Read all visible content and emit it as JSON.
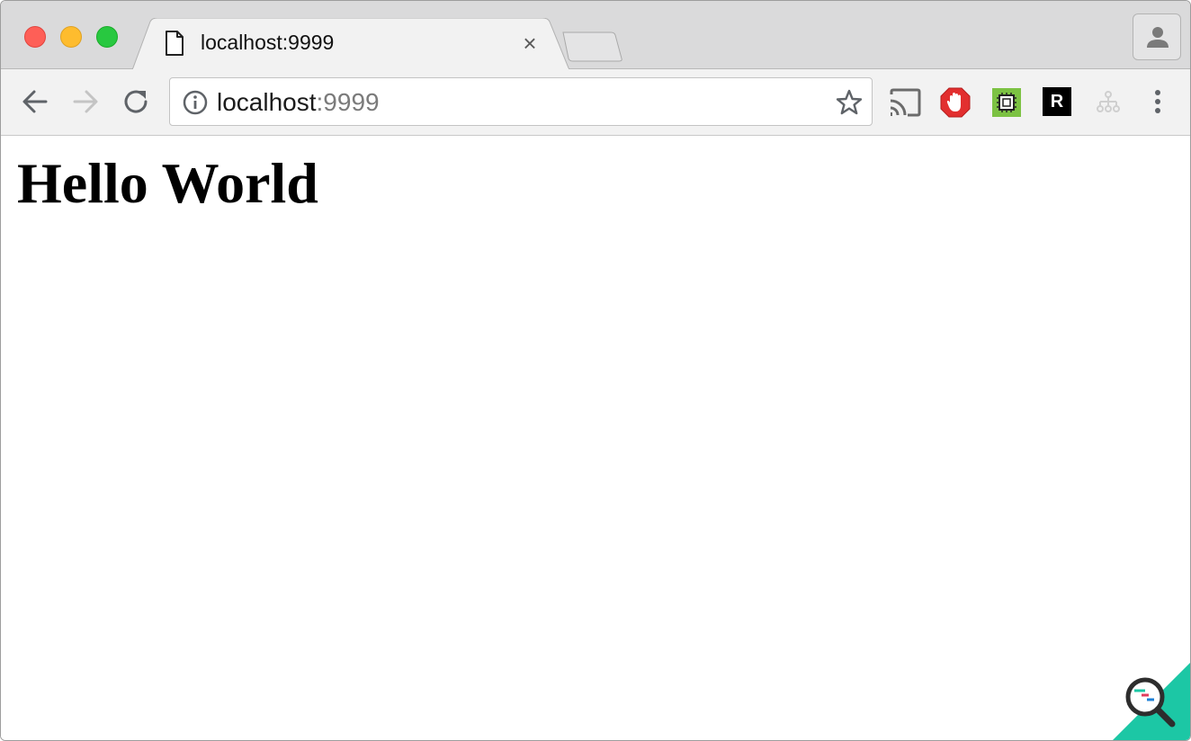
{
  "window": {
    "controls": [
      "close",
      "minimize",
      "maximize"
    ]
  },
  "tab": {
    "title": "localhost:9999",
    "favicon": "page-icon",
    "close_icon": "×"
  },
  "toolbar": {
    "back_icon": "arrow-left-icon",
    "forward_icon": "arrow-right-icon",
    "reload_icon": "reload-icon",
    "extensions": [
      "cast-icon",
      "adblock-icon",
      "green-extension-icon",
      "r-extension-icon",
      "sitemap-icon"
    ],
    "r_extension_label": "R",
    "menu_icon": "more-vertical-icon"
  },
  "omnibox": {
    "host": "localhost",
    "port": ":9999",
    "info_icon": "info-icon",
    "bookmark_icon": "star-icon"
  },
  "page": {
    "heading": "Hello World"
  },
  "colors": {
    "tabstrip_bg": "#dadadb",
    "toolbar_bg": "#f2f2f2",
    "close_red": "#fe5f57",
    "minimize_yellow": "#febc2e",
    "maximize_green": "#28c840",
    "badge_teal": "#1cc7a5"
  }
}
